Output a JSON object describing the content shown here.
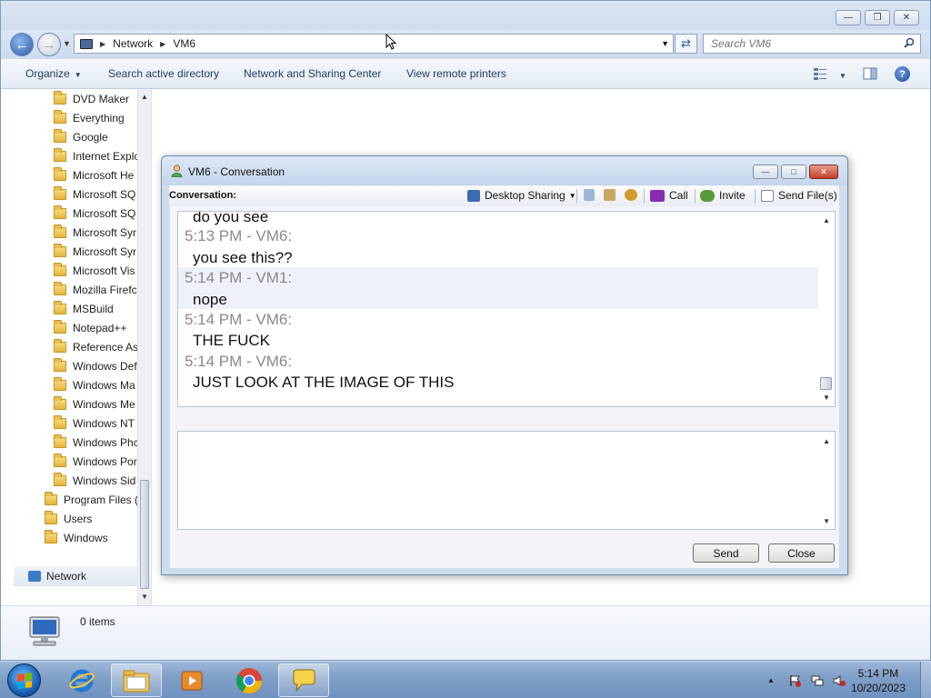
{
  "explorer": {
    "breadcrumb": [
      "Network",
      "VM6"
    ],
    "search_placeholder": "Search VM6",
    "commands": {
      "organize": "Organize",
      "search_ad": "Search active directory",
      "network_sharing": "Network and Sharing Center",
      "remote_printers": "View remote printers"
    },
    "tree": [
      "DVD Maker",
      "Everything",
      "Google",
      "Internet Explo",
      "Microsoft He",
      "Microsoft SQ",
      "Microsoft SQ",
      "Microsoft Syr",
      "Microsoft Syr",
      "Microsoft Vis",
      "Mozilla Firefc",
      "MSBuild",
      "Notepad++",
      "Reference As",
      "Windows Def",
      "Windows Ma",
      "Windows Me",
      "Windows NT",
      "Windows Phc",
      "Windows Por",
      "Windows Sid"
    ],
    "tree_root": [
      "Program Files (",
      "Users",
      "Windows"
    ],
    "network_label": "Network",
    "items_count": "0 items"
  },
  "conversation": {
    "title": "VM6 - Conversation",
    "label": "Conversation:",
    "toolbar": {
      "desktop_sharing": "Desktop Sharing",
      "call": "Call",
      "invite": "Invite",
      "send_files": "Send File(s)"
    },
    "messages": [
      {
        "header": "",
        "text": "do you see"
      },
      {
        "header": "5:13 PM - VM6:",
        "text": "you see this??"
      },
      {
        "header": "5:14 PM - VM1:",
        "text": "nope"
      },
      {
        "header": "5:14 PM - VM6:",
        "text": "THE FUCK"
      },
      {
        "header": "5:14 PM - VM6:",
        "text": "JUST LOOK AT THE IMAGE OF THIS"
      }
    ],
    "send_label": "Send",
    "close_label": "Close"
  },
  "taskbar": {
    "time": "5:14 PM",
    "date": "10/20/2023"
  },
  "colors": {
    "accent": "#2b5aa8",
    "timestamp": "#8a8a8a",
    "highlight_band": "#eef1f7"
  }
}
